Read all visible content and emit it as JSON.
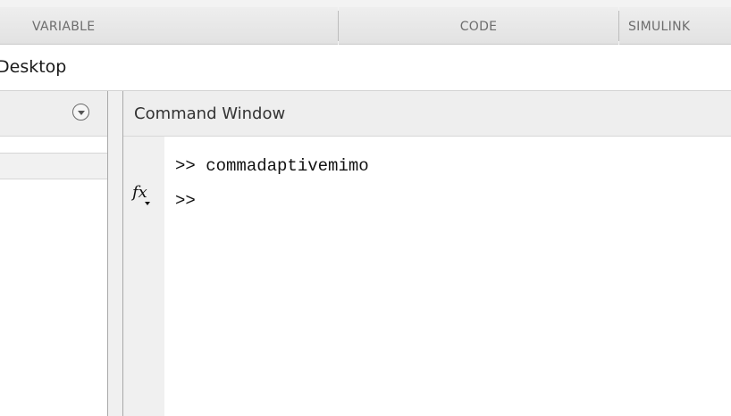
{
  "toolstrip": {
    "sections": [
      "VARIABLE",
      "CODE",
      "SIMULINK"
    ]
  },
  "address_bar": {
    "path": "Desktop"
  },
  "left_panel": {
    "dropdown_icon": "circle-chevron-down-icon"
  },
  "command_window": {
    "title": "Command Window",
    "history": [
      {
        "prompt": ">>",
        "command": "commadaptivemimo"
      }
    ],
    "current_prompt": ">>",
    "function_browser_icon": "fx-icon"
  }
}
